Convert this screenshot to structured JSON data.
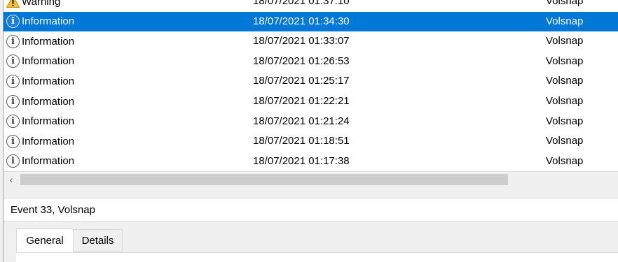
{
  "event_list": {
    "rows": [
      {
        "level": "Warning",
        "icon": "warning-icon",
        "date": "18/07/2021 01:37:10",
        "source": "Volsnap",
        "selected": false
      },
      {
        "level": "Information",
        "icon": "info-icon",
        "date": "18/07/2021 01:34:30",
        "source": "Volsnap",
        "selected": true
      },
      {
        "level": "Information",
        "icon": "info-icon",
        "date": "18/07/2021 01:33:07",
        "source": "Volsnap",
        "selected": false
      },
      {
        "level": "Information",
        "icon": "info-icon",
        "date": "18/07/2021 01:26:53",
        "source": "Volsnap",
        "selected": false
      },
      {
        "level": "Information",
        "icon": "info-icon",
        "date": "18/07/2021 01:25:17",
        "source": "Volsnap",
        "selected": false
      },
      {
        "level": "Information",
        "icon": "info-icon",
        "date": "18/07/2021 01:22:21",
        "source": "Volsnap",
        "selected": false
      },
      {
        "level": "Information",
        "icon": "info-icon",
        "date": "18/07/2021 01:21:24",
        "source": "Volsnap",
        "selected": false
      },
      {
        "level": "Information",
        "icon": "info-icon",
        "date": "18/07/2021 01:18:51",
        "source": "Volsnap",
        "selected": false
      },
      {
        "level": "Information",
        "icon": "info-icon",
        "date": "18/07/2021 01:17:38",
        "source": "Volsnap",
        "selected": false
      }
    ]
  },
  "scrollbar": {
    "left_arrow": "‹"
  },
  "details": {
    "title": "Event 33, Volsnap",
    "tabs": [
      {
        "label": "General",
        "active": true
      },
      {
        "label": "Details",
        "active": false
      }
    ]
  },
  "colors": {
    "selection": "#0078d7",
    "warning": "#f4c22b"
  }
}
